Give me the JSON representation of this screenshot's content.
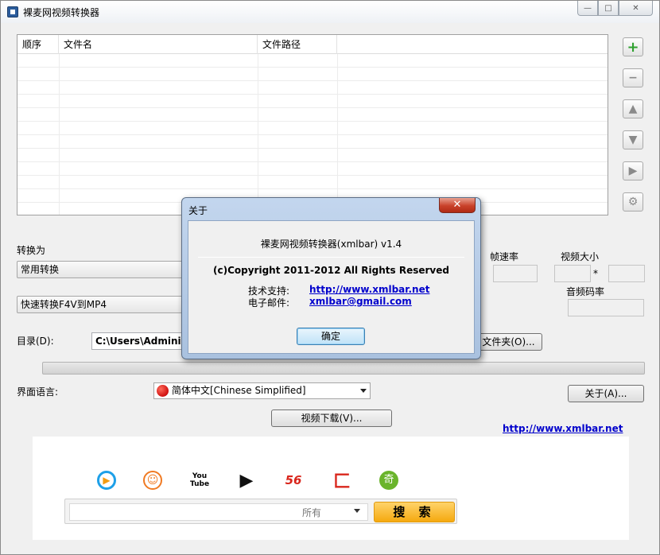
{
  "window": {
    "title": "裸麦网视频转换器",
    "controls": {
      "minimize": "—",
      "maximize": "□",
      "close": "✕"
    }
  },
  "file_list": {
    "columns": [
      "顺序",
      "文件名",
      "文件路径"
    ]
  },
  "side_buttons": [
    {
      "name": "add-file-button",
      "icon": "plus-icon",
      "glyph": "+"
    },
    {
      "name": "remove-file-button",
      "icon": "minus-icon",
      "glyph": "−"
    },
    {
      "name": "move-up-button",
      "icon": "arrow-up-icon",
      "glyph": "▲"
    },
    {
      "name": "move-down-button",
      "icon": "arrow-down-icon",
      "glyph": "▼"
    },
    {
      "name": "start-convert-button",
      "icon": "play-icon",
      "glyph": "▶"
    },
    {
      "name": "settings-button",
      "icon": "gears-icon",
      "glyph": "⚙"
    }
  ],
  "convert": {
    "label": "转换为",
    "category_value": "常用转换",
    "preset_value": "快速转换F4V到MP4",
    "framerate_label": "帧速率",
    "video_size_label": "视频大小",
    "size_separator": "*",
    "audio_bitrate_label": "音频码率"
  },
  "directory": {
    "label": "目录(D):",
    "value": "C:\\Users\\Administrator",
    "open_folder_label": "文件夹(O)..."
  },
  "progress": {
    "value": 0
  },
  "language": {
    "label": "界面语言:",
    "value": "简体中文[Chinese Simplified]"
  },
  "about_button_label": "关于(A)...",
  "download_button_label": "视频下载(V)...",
  "website_link": "http://www.xmlbar.net",
  "search": {
    "scope": "所有",
    "button_label": "搜 索",
    "sites": [
      {
        "name": "youku-icon",
        "glyph": "▶",
        "color": "#1ea0e8"
      },
      {
        "name": "tudou-icon",
        "glyph": "☺",
        "color": "#f07a22"
      },
      {
        "name": "youtube-icon",
        "glyph": "You\nTube",
        "color": "#cc181e"
      },
      {
        "name": "iqiyi-play-icon",
        "glyph": "▶",
        "color": "#111111"
      },
      {
        "name": "site-56-icon",
        "glyph": "56",
        "color": "#d9261c"
      },
      {
        "name": "sohu-icon",
        "glyph": "匚",
        "color": "#d9261c"
      },
      {
        "name": "qiyi-icon",
        "glyph": "奇",
        "color": "#6ab42c"
      }
    ]
  },
  "about_dialog": {
    "title": "关于",
    "close": "✕",
    "product": "裸麦网视频转换器(xmlbar) v1.4",
    "copyright": "(c)Copyright 2011-2012 All Rights Reserved",
    "support_label": "技术支持:",
    "support_link": "http://www.xmlbar.net",
    "email_label": "电子邮件:",
    "email_link": "xmlbar@gmail.com",
    "ok_label": "确定"
  }
}
